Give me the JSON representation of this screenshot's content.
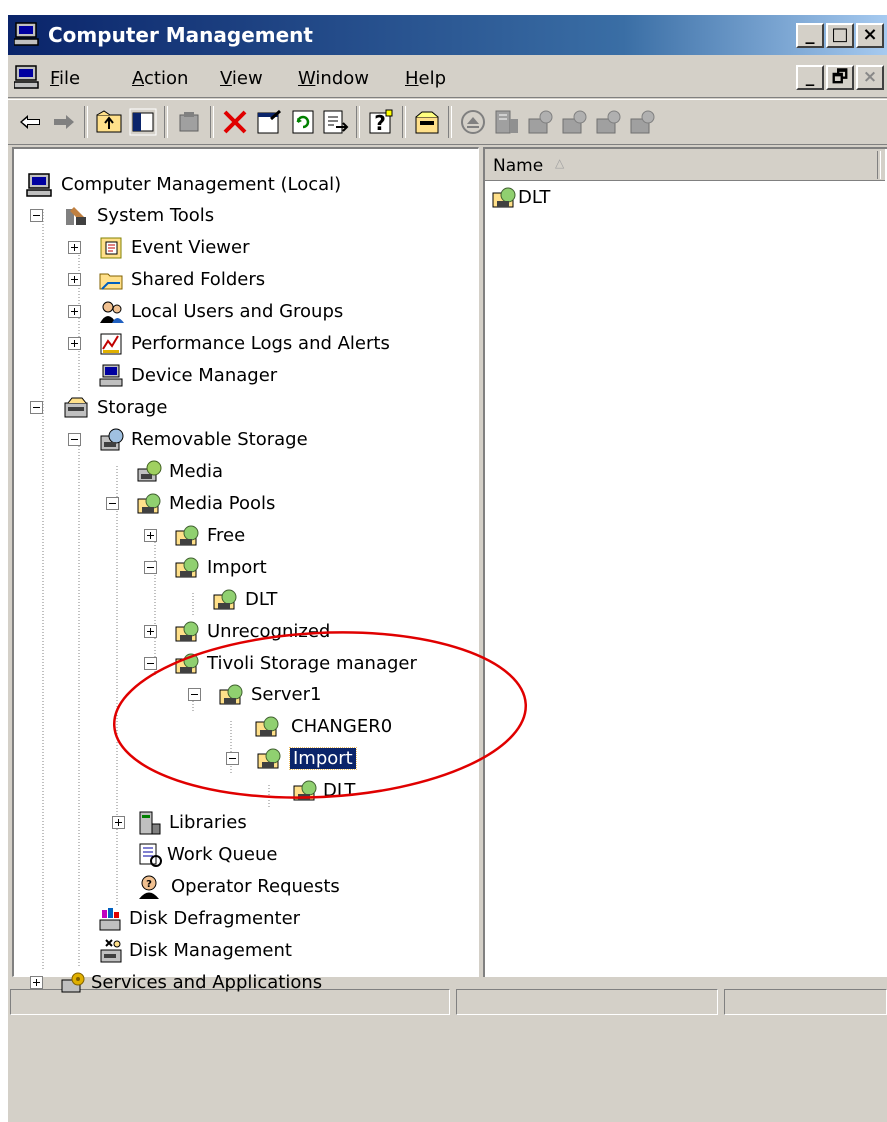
{
  "window": {
    "title": "Computer Management",
    "caption_buttons": [
      "_",
      "□",
      "×"
    ]
  },
  "menubar": {
    "items": [
      {
        "label": "File",
        "underline": "F",
        "rest": "ile"
      },
      {
        "label": "Action",
        "underline": "A",
        "rest": "ction"
      },
      {
        "label": "View",
        "underline": "V",
        "rest": "iew"
      },
      {
        "label": "Window",
        "underline": "W",
        "rest": "indow"
      },
      {
        "label": "Help",
        "underline": "H",
        "rest": "elp"
      }
    ],
    "mdi_buttons": [
      "_",
      "🗗",
      "×"
    ]
  },
  "toolbar": {
    "buttons": [
      "back-icon",
      "forward-icon",
      "up-folder-icon",
      "show-hide-tree-icon",
      "export-icon",
      "delete-icon",
      "properties-icon",
      "refresh-icon",
      "export-list-icon",
      "help-icon",
      "new-pool-icon",
      "eject-icon",
      "mount-icon",
      "library-icon",
      "library-icon-2",
      "library-icon-3",
      "library-icon-4"
    ]
  },
  "tree": {
    "root": "Computer Management (Local)",
    "system_tools": "System Tools",
    "event_viewer": "Event Viewer",
    "shared_folders": "Shared Folders",
    "local_users": "Local Users and Groups",
    "perf_logs": "Performance Logs and Alerts",
    "device_manager": "Device Manager",
    "storage": "Storage",
    "removable_storage": "Removable Storage",
    "media": "Media",
    "media_pools": "Media Pools",
    "free": "Free",
    "import": "Import",
    "import_dlt": "DLT",
    "unrecognized": "Unrecognized",
    "tivoli": "Tivoli Storage manager",
    "server1": "Server1",
    "changer0": "CHANGER0",
    "tsm_import": "Import",
    "tsm_import_dlt": "DLT",
    "libraries": "Libraries",
    "work_queue": "Work Queue",
    "operator_requests": "Operator Requests",
    "disk_defrag": "Disk Defragmenter",
    "disk_management": "Disk Management",
    "services_apps": "Services and Applications"
  },
  "list": {
    "column_name": "Name",
    "sort_indicator": "△",
    "items": [
      "DLT"
    ]
  },
  "annotation": {
    "color": "#e00000"
  }
}
